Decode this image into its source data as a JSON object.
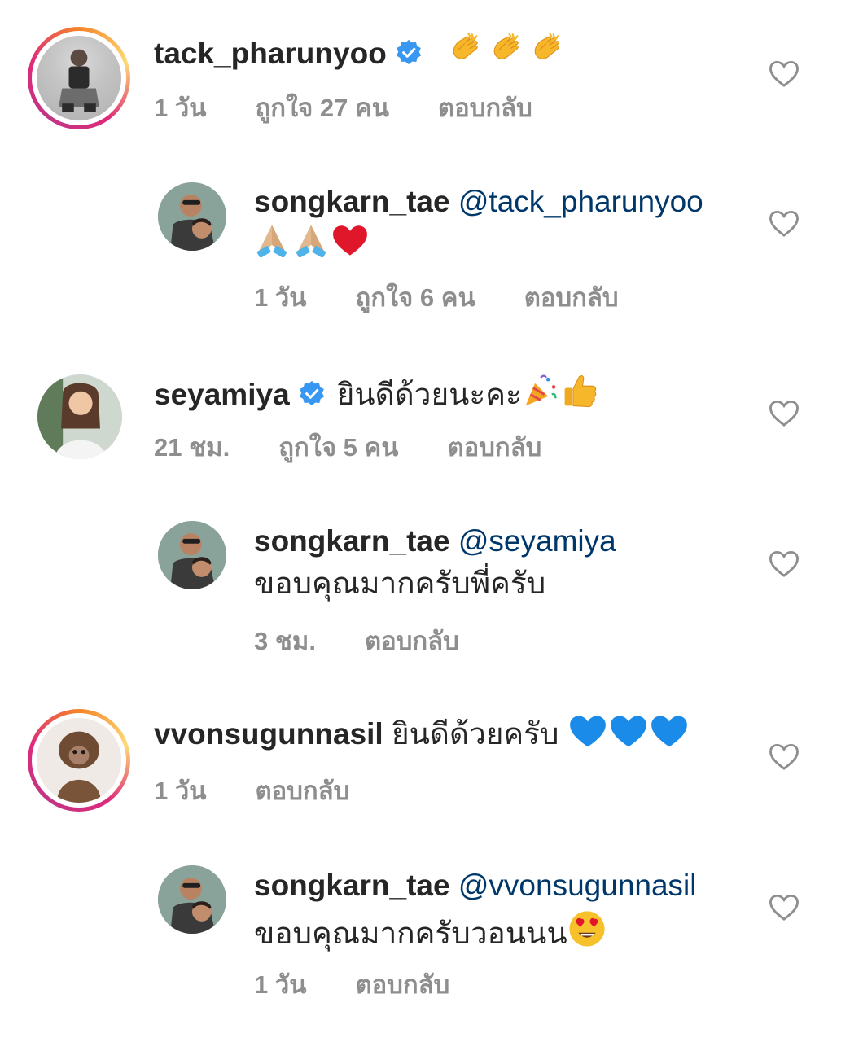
{
  "comments": [
    {
      "username": "tack_pharunyoo",
      "verified": true,
      "text": "",
      "emoji": "clapping-hands-x3",
      "time": "1 วัน",
      "likes": "ถูกใจ 27 คน",
      "reply": "ตอบกลับ",
      "avatar_ring": true
    },
    {
      "username": "songkarn_tae",
      "mention": "@tack_pharunyoo",
      "text": "",
      "emoji": "folded-hands-x2-red-heart",
      "time": "1 วัน",
      "likes": "ถูกใจ 6 คน",
      "reply": "ตอบกลับ"
    },
    {
      "username": "seyamiya",
      "verified": true,
      "text": "ยินดีด้วยนะคะ",
      "emoji": "party-popper-thumbs-up",
      "time": "21 ชม.",
      "likes": "ถูกใจ 5 คน",
      "reply": "ตอบกลับ"
    },
    {
      "username": "songkarn_tae",
      "mention": "@seyamiya",
      "text": "ขอบคุณมากครับพี่ครับ",
      "time": "3 ชม.",
      "reply": "ตอบกลับ"
    },
    {
      "username": "vvonsugunnasil",
      "text": "ยินดีด้วยครับ",
      "emoji": "blue-heart-x3",
      "time": "1 วัน",
      "reply": "ตอบกลับ",
      "avatar_ring": true
    },
    {
      "username": "songkarn_tae",
      "mention": "@vvonsugunnasil",
      "text": "ขอบคุณมากครับวอนนน",
      "emoji": "heart-eyes-face",
      "time": "1 วัน",
      "reply": "ตอบกลับ"
    }
  ],
  "colors": {
    "username": "#262626",
    "mention": "#00376b",
    "meta": "#8e8e8e",
    "verified": "#3897f0"
  },
  "icons": {
    "like": "heart-outline-icon",
    "verified": "verified-badge-icon"
  }
}
